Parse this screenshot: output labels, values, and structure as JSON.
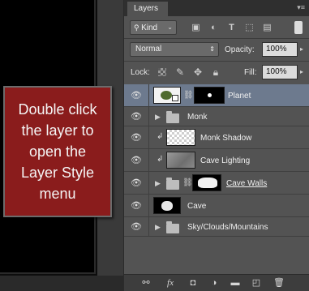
{
  "callout": {
    "text": "Double click\nthe layer to\nopen the\nLayer Style\nmenu"
  },
  "panel": {
    "tab_label": "Layers",
    "menu_icon": "panel-menu-icon",
    "filter": {
      "kind_label": "Kind",
      "icons": [
        "image-filter-icon",
        "adjustment-filter-icon",
        "type-filter-icon",
        "shape-filter-icon",
        "smart-object-filter-icon"
      ],
      "type_glyph": "T"
    },
    "blend_mode": "Normal",
    "opacity_label": "Opacity:",
    "opacity_value": "100%",
    "lock_label": "Lock:",
    "fill_label": "Fill:",
    "fill_value": "100%"
  },
  "layers": [
    {
      "name": "Planet",
      "kind": "smart-with-mask",
      "selected": true
    },
    {
      "name": "Monk",
      "kind": "group"
    },
    {
      "name": "Monk Shadow",
      "kind": "clipped-transparent"
    },
    {
      "name": "Cave Lighting",
      "kind": "clipped-gray"
    },
    {
      "name": "Cave Walls",
      "kind": "group-with-mask"
    },
    {
      "name": "Cave",
      "kind": "layer-black"
    },
    {
      "name": "Sky/Clouds/Mountains",
      "kind": "group"
    }
  ],
  "footer_icons": [
    "link-layers-icon",
    "fx-icon",
    "add-mask-icon",
    "adjustment-layer-icon",
    "new-group-icon",
    "new-layer-icon",
    "trash-icon"
  ],
  "colors": {
    "callout_bg": "#8a1c1c",
    "selected_layer": "#6d7a8e",
    "panel_bg": "#535353"
  }
}
